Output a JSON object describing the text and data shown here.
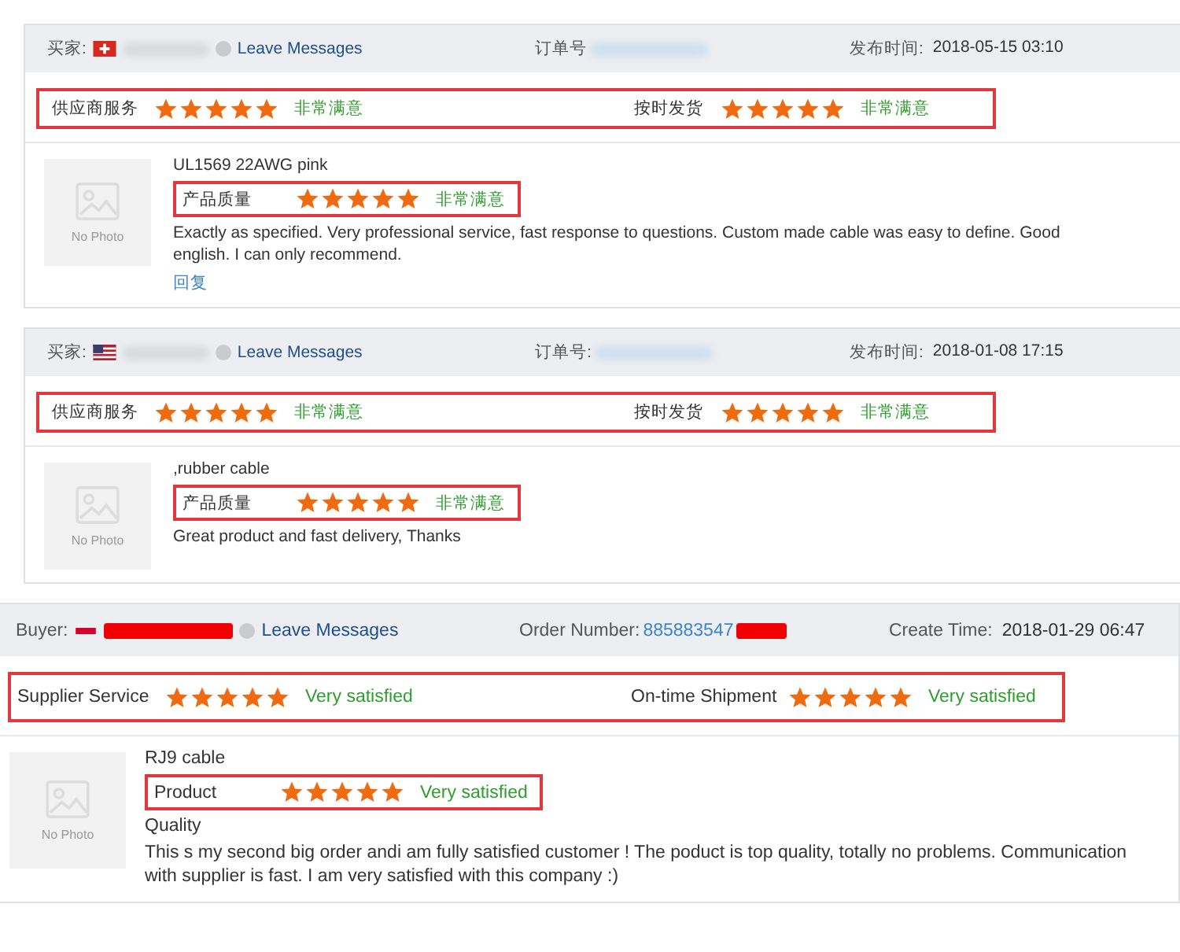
{
  "reviews": [
    {
      "kind": "inset",
      "header": {
        "buyer_label": "买家:",
        "flag": {
          "kind": "ch"
        },
        "redaction": {
          "kind": "blur"
        },
        "leave_messages": "Leave Messages",
        "order_label": "订单号",
        "time_label": "发布时间:",
        "time": "2018-05-15 03:10"
      },
      "ratings": [
        {
          "label": "供应商服务",
          "stars": 5,
          "verdict": "非常满意"
        },
        {
          "label": "按时发货",
          "stars": 5,
          "verdict": "非常满意"
        }
      ],
      "product": {
        "photo": "No Photo",
        "title": "UL1569 22AWG pink",
        "rating": {
          "label": "产品质量",
          "stars": 5,
          "verdict": "非常满意"
        },
        "comment": "Exactly as specified. Very professional service, fast response to questions. Custom made cable was easy to define. Good english. I can only recommend.",
        "reply": "回复"
      }
    },
    {
      "kind": "inset",
      "header": {
        "buyer_label": "买家:",
        "flag": {
          "kind": "us"
        },
        "redaction": {
          "kind": "blur"
        },
        "leave_messages": "Leave Messages",
        "order_label": "订单号:",
        "time_label": "发布时间:",
        "time": "2018-01-08 17:15"
      },
      "ratings": [
        {
          "label": "供应商服务",
          "stars": 5,
          "verdict": "非常满意"
        },
        {
          "label": "按时发货",
          "stars": 5,
          "verdict": "非常满意"
        }
      ],
      "product": {
        "photo": "No Photo",
        "title": ",rubber cable",
        "rating": {
          "label": "产品质量",
          "stars": 5,
          "verdict": "非常满意"
        },
        "comment": "Great product and fast delivery, Thanks"
      }
    },
    {
      "kind": "full",
      "header": {
        "buyer_label": "Buyer:",
        "flag": {
          "kind": "red"
        },
        "redaction": {
          "kind": "bar"
        },
        "leave_messages": "Leave Messages",
        "order_label": "Order Number:",
        "order_number": "885883547",
        "time_label": "Create Time:",
        "time": "2018-01-29 06:47"
      },
      "ratings": [
        {
          "label": "Supplier Service",
          "stars": 5,
          "verdict": "Very satisfied"
        },
        {
          "label": "On-time Shipment",
          "stars": 5,
          "verdict": "Very satisfied"
        }
      ],
      "product": {
        "photo": "No Photo",
        "title": "RJ9 cable",
        "rating": {
          "label": "Product",
          "stars": 5,
          "verdict": "Very satisfied"
        },
        "rating_overflow": "Quality",
        "comment": "This s my second big order andi am fully satisfied customer ! The poduct is top quality, totally no problems. Communication with supplier is fast. I am very satisfied with this company :)"
      }
    }
  ]
}
